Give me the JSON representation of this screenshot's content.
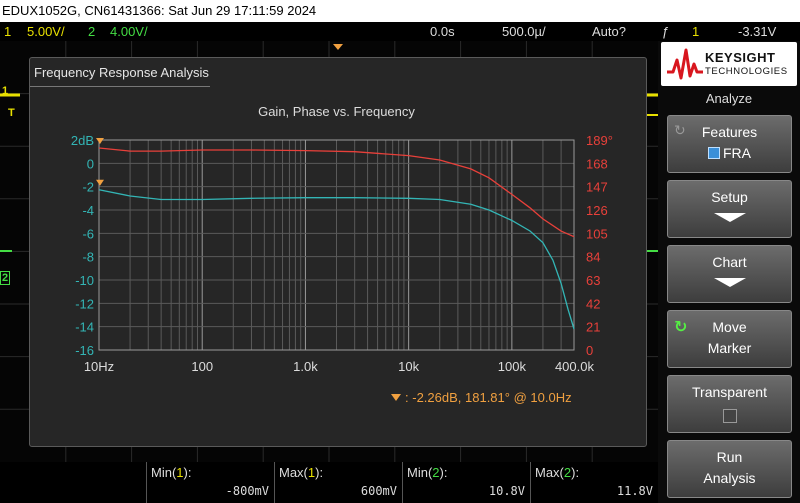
{
  "title_bar": "EDUX1052G, CN61431366: Sat Jun 29 17:11:59 2024",
  "status": {
    "ch1_num": "1",
    "ch1_scale": "5.00V/",
    "ch2_num": "2",
    "ch2_scale": "4.00V/",
    "delay": "0.0s",
    "timebase": "500.0µ/",
    "trigger_mode": "Auto?",
    "trigger_icon": "ƒ",
    "trigger_ch": "1",
    "trigger_level": "-3.31V"
  },
  "markers": {
    "ch1": "1",
    "trig": "T",
    "ch2": "2"
  },
  "fra": {
    "window_title": "Frequency Response Analysis",
    "marker_readout": "-2.26dB, 181.81° @ 10.0Hz",
    "marker_readout_prefix": ":"
  },
  "chart_data": {
    "type": "line",
    "title": "Gain, Phase vs. Frequency",
    "xscale": "log",
    "xlim": [
      10,
      400000
    ],
    "x_ticks": [
      "10Hz",
      "100",
      "1.0k",
      "10k",
      "100k",
      "400.0k"
    ],
    "y_left_ticks": [
      "2dB",
      "0",
      "-2",
      "-4",
      "-6",
      "-8",
      "-10",
      "-12",
      "-14",
      "-16"
    ],
    "y_left_lim": [
      -16,
      2
    ],
    "y_right_ticks": [
      "189°",
      "168",
      "147",
      "126",
      "105",
      "84",
      "63",
      "42",
      "21",
      "0"
    ],
    "y_right_lim": [
      0,
      189
    ],
    "grid": true,
    "series": [
      {
        "axis": "left",
        "color": "#33b5b5",
        "x": [
          10,
          20,
          40,
          100,
          300,
          1000,
          3000,
          10000,
          20000,
          40000,
          60000,
          100000,
          150000,
          200000,
          250000,
          300000,
          350000,
          400000
        ],
        "y": [
          -2.26,
          -2.8,
          -3.1,
          -3.1,
          -3.0,
          -2.95,
          -2.95,
          -3.0,
          -3.1,
          -3.5,
          -4.0,
          -4.9,
          -5.8,
          -6.8,
          -8.3,
          -10.3,
          -12.5,
          -14.2
        ]
      },
      {
        "axis": "right",
        "color": "#e8403a",
        "x": [
          10,
          20,
          40,
          100,
          300,
          1000,
          3000,
          10000,
          20000,
          40000,
          60000,
          100000,
          150000,
          200000,
          300000,
          400000
        ],
        "y": [
          181.8,
          179,
          179,
          180,
          180,
          179.5,
          178.5,
          175,
          171,
          163,
          155,
          140,
          128,
          118,
          107,
          102
        ]
      }
    ]
  },
  "panel": {
    "brand": "KEYSIGHT",
    "brand_sub": "TECHNOLOGIES",
    "menu_title": "Analyze",
    "softkeys": [
      {
        "l1": "Features",
        "l2": "FRA"
      },
      {
        "l1": "Setup"
      },
      {
        "l1": "Chart"
      },
      {
        "l1": "Move",
        "l2": "Marker"
      },
      {
        "l1": "Transparent"
      },
      {
        "l1": "Run",
        "l2": "Analysis"
      }
    ]
  },
  "measurements": [
    {
      "label_pre": "Min(",
      "ch": "1",
      "label_post": "):",
      "value": "-800mV",
      "ch_color": "#e8e000"
    },
    {
      "label_pre": "Max(",
      "ch": "1",
      "label_post": "):",
      "value": "600mV",
      "ch_color": "#e8e000"
    },
    {
      "label_pre": "Min(",
      "ch": "2",
      "label_post": "):",
      "value": "10.8V",
      "ch_color": "#44dd44"
    },
    {
      "label_pre": "Max(",
      "ch": "2",
      "label_post": "):",
      "value": "11.8V",
      "ch_color": "#44dd44"
    }
  ]
}
